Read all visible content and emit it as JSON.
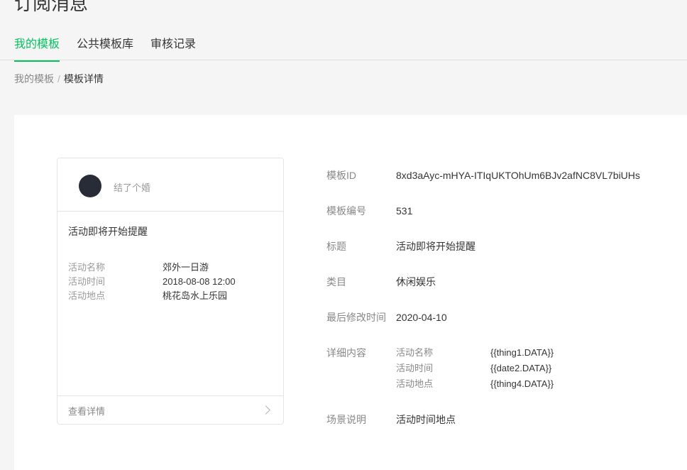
{
  "page": {
    "title": "订阅消息"
  },
  "tabs": [
    {
      "label": "我的模板",
      "active": true
    },
    {
      "label": "公共模板库",
      "active": false
    },
    {
      "label": "审核记录",
      "active": false
    }
  ],
  "breadcrumb": {
    "parent": "我的模板",
    "separator": "/",
    "current": "模板详情"
  },
  "preview": {
    "account_name": "结了个婚",
    "title": "活动即将开始提醒",
    "fields": [
      {
        "key": "活动名称",
        "value": "郊外一日游"
      },
      {
        "key": "活动时间",
        "value": "2018-08-08 12:00"
      },
      {
        "key": "活动地点",
        "value": "桃花岛水上乐园"
      }
    ],
    "footer_label": "查看详情"
  },
  "details": {
    "template_id": {
      "label": "模板ID",
      "value": "8xd3aAyc-mHYA-ITIqUKTOhUm6BJv2afNC8VL7biUHs"
    },
    "template_number": {
      "label": "模板编号",
      "value": "531"
    },
    "title": {
      "label": "标题",
      "value": "活动即将开始提醒"
    },
    "category": {
      "label": "类目",
      "value": "休闲娱乐"
    },
    "last_modified": {
      "label": "最后修改时间",
      "value": "2020-04-10"
    },
    "content": {
      "label": "详细内容",
      "rows": [
        {
          "key": "活动名称",
          "value": "{{thing1.DATA}}"
        },
        {
          "key": "活动时间",
          "value": "{{date2.DATA}}"
        },
        {
          "key": "活动地点",
          "value": "{{thing4.DATA}}"
        }
      ]
    },
    "scene": {
      "label": "场景说明",
      "value": "活动时间地点"
    }
  },
  "colors": {
    "accent": "#07c160",
    "avatar": "#272c36"
  }
}
